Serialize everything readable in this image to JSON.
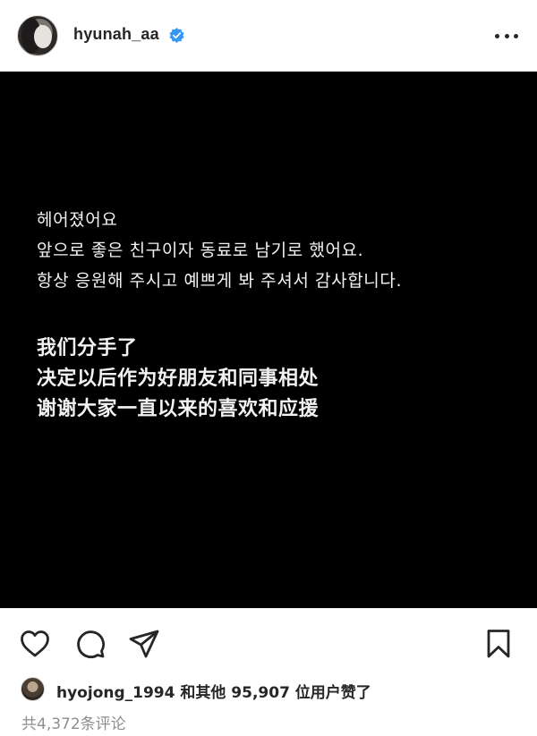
{
  "header": {
    "username": "hyunah_aa"
  },
  "post": {
    "korean_lines": [
      "헤어졌어요",
      "앞으로 좋은 친구이자 동료로 남기로 했어요.",
      "항상 응원해 주시고 예쁘게 봐 주셔서 감사합니다."
    ],
    "chinese_lines": [
      "我们分手了",
      "决定以后作为好朋友和同事相处",
      "谢谢大家一直以来的喜欢和应援"
    ]
  },
  "actions": {
    "icons": [
      "heart-icon",
      "comment-icon",
      "share-icon",
      "bookmark-icon"
    ]
  },
  "likes": {
    "liker_username": "hyojong_1994",
    "text": "hyojong_1994 和其他 95,907 位用户赞了"
  },
  "comments": {
    "text": "共4,372条评论"
  },
  "colors": {
    "verified": "#3897f0",
    "post_background": "#000000",
    "text": "#262626",
    "muted": "#8e8e8e"
  }
}
